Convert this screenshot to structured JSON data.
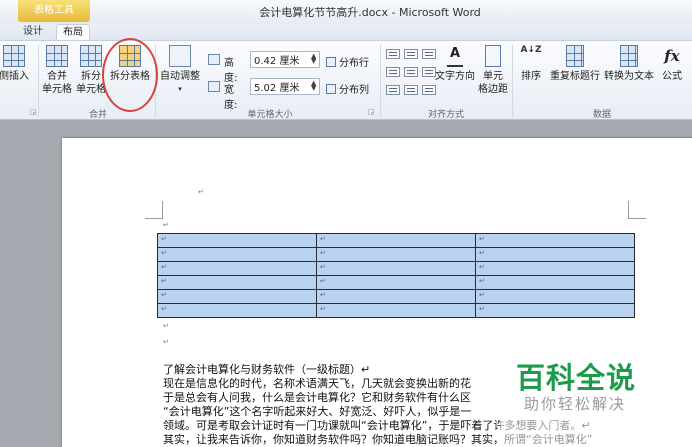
{
  "window": {
    "context_tab": "表格工具",
    "title": "会计电算化节节高升.docx - Microsoft Word"
  },
  "tabs": {
    "design": "设计",
    "layout": "布局"
  },
  "ribbon": {
    "insert_partial": "侧插入",
    "merge_group": {
      "label": "合并",
      "merge_cells_line1": "合并",
      "merge_cells_line2": "单元格",
      "split_cells_line1": "拆分",
      "split_cells_line2": "单元格",
      "split_table": "拆分表格"
    },
    "cell_size_group": {
      "label": "单元格大小",
      "autofit": "自动调整",
      "height_label": "高度:",
      "height_value": "0.42 厘米",
      "width_label": "宽度:",
      "width_value": "5.02 厘米",
      "distribute_rows": "分布行",
      "distribute_cols": "分布列"
    },
    "alignment_group": {
      "label": "对齐方式",
      "text_direction": "文字方向",
      "cell_margins_line1": "单元",
      "cell_margins_line2": "格边距"
    },
    "data_group": {
      "label": "数据",
      "sort": "排序",
      "repeat_header": "重复标题行",
      "convert_to_text": "转换为文本",
      "formula": "公式",
      "formula_icon_text": "fx"
    },
    "sort_icon_text": "A↓Z"
  },
  "document": {
    "para_mark": "↵",
    "cell_mark": "↵",
    "lines": [
      "了解会计电算化与财务软件（一级标题）↵",
      "现在是信息化的时代，名称术语满天飞，几天就会变换出新的花",
      "于是总会有人问我，什么是会计电算化？它和财务软件有什么区",
      "“会计电算化”这个名字听起来好大、好宽泛、好吓人，似乎是一",
      "领域。可是考取会计证时有一门功课就叫“会计电算化”，于是吓着了许多想要入门者。↵",
      "其实，让我来告诉你，你知道财务软件吗？你知道电脑记账吗？其实，所谓“会计电算化”"
    ]
  },
  "watermark": {
    "main": "百科全说",
    "sub": "助你轻松解决"
  }
}
